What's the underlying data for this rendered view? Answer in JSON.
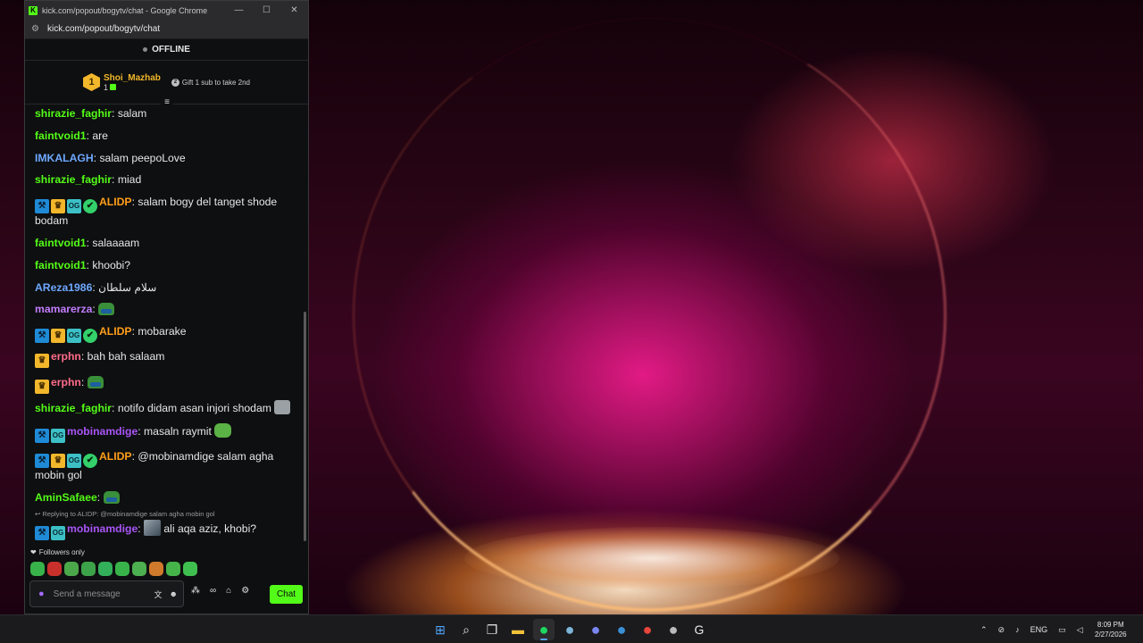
{
  "window": {
    "title": "kick.com/popout/bogytv/chat - Google Chrome",
    "url": "kick.com/popout/bogytv/chat",
    "logo": "K",
    "controls": [
      "—",
      "☐",
      "✕"
    ]
  },
  "stream": {
    "status": "OFFLINE"
  },
  "leaderboard": {
    "rank": "1",
    "name": "Shoi_Mazhab",
    "count": "1",
    "gift_rank": "2",
    "gift_note": "Gift 1 sub to take 2nd"
  },
  "messages": [
    {
      "user": "shirazie_faghir",
      "color": "#53fc18",
      "text": "salam",
      "badges": [],
      "emotes": []
    },
    {
      "user": "faintvoid1",
      "color": "#53fc18",
      "text": "are",
      "badges": [],
      "emotes": []
    },
    {
      "user": "IMKALAGH",
      "color": "#6ea8ff",
      "text": "salam peepoLove",
      "badges": [],
      "emotes": []
    },
    {
      "user": "shirazie_faghir",
      "color": "#53fc18",
      "text": "miad",
      "badges": [],
      "emotes": []
    },
    {
      "user": "ALIDP",
      "color": "#ff9f1a",
      "text": "salam bogy del tanget shode bodam",
      "badges": [
        "mod",
        "crown",
        "og",
        "verified"
      ],
      "emotes": []
    },
    {
      "user": "faintvoid1",
      "color": "#53fc18",
      "text": "salaaaam",
      "badges": [],
      "emotes": []
    },
    {
      "user": "faintvoid1",
      "color": "#53fc18",
      "text": "khoobi?",
      "badges": [],
      "emotes": []
    },
    {
      "user": "AReza1986",
      "color": "#6ea8ff",
      "text": "سلام سلطان",
      "badges": [],
      "emotes": []
    },
    {
      "user": "mamarerza",
      "color": "#c27dff",
      "text": "",
      "badges": [],
      "emotes": [
        "pepe-emote"
      ]
    },
    {
      "user": "ALIDP",
      "color": "#ff9f1a",
      "text": "mobarake",
      "badges": [
        "mod",
        "crown",
        "og",
        "verified"
      ],
      "emotes": []
    },
    {
      "user": "erphn",
      "color": "#ff6b8a",
      "text": "bah bah salaam",
      "badges": [
        "crown"
      ],
      "emotes": []
    },
    {
      "user": "erphn",
      "color": "#ff6b8a",
      "text": "",
      "badges": [
        "crown"
      ],
      "emotes": [
        "pepe-emote"
      ]
    },
    {
      "user": "shirazie_faghir",
      "color": "#53fc18",
      "text": "notifo didam asan injori shodam",
      "badges": [],
      "emotes": [
        "cat-emote"
      ]
    },
    {
      "user": "mobinamdige",
      "color": "#a855f7",
      "text": "masaln raymit",
      "badges": [
        "mod",
        "og"
      ],
      "emotes": [
        "frog-emote"
      ]
    },
    {
      "user": "ALIDP",
      "color": "#ff9f1a",
      "text": "@mobinamdige salam agha mobin gol",
      "badges": [
        "mod",
        "crown",
        "og",
        "verified"
      ],
      "emotes": []
    },
    {
      "user": "AminSafaee",
      "color": "#53fc18",
      "text": "",
      "badges": [],
      "emotes": [
        "pepe-emote"
      ]
    },
    {
      "user": "mobinamdige",
      "color": "#a855f7",
      "text": "ali aqa aziz, khobi?",
      "badges": [
        "mod",
        "og"
      ],
      "emotes": [
        "photo-emote"
      ],
      "reply": "Replying to ALIDP: @mobinamdige salam agha mobin gol"
    }
  ],
  "chat_mode": "Followers only",
  "emote_tray": [
    "#38b24a",
    "#c9302c",
    "#4aa84a",
    "#3da34a",
    "#33b05a",
    "#37b34a",
    "#4caf50",
    "#d07a2c",
    "#45b34a",
    "#3fbf4f"
  ],
  "composer": {
    "placeholder": "Send a message",
    "send_label": "Chat"
  },
  "taskbar": {
    "apps": [
      "windows-start",
      "search",
      "task-view",
      "file-explorer",
      "spotify",
      "steam",
      "discord",
      "vpn",
      "chrome",
      "obs",
      "logitech"
    ],
    "lang": "ENG",
    "time": "8:09 PM",
    "date": "2/27/2026"
  }
}
